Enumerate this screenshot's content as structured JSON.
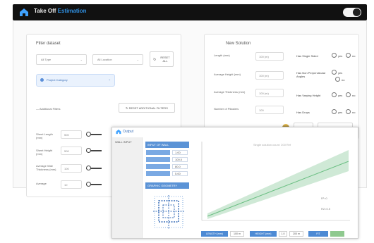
{
  "app": {
    "title_main": "Take Off",
    "title_sub": "Estimation"
  },
  "filter": {
    "title": "Filter dataset",
    "type_value": "All Type",
    "location_value": "All Location",
    "reset_label": "RESET ALL",
    "chip_label": "Project Category",
    "additional_label": "Additional Filters",
    "reset_additional_label": "RESET ADDITIONAL FILTERS",
    "rows": [
      {
        "label": "Sheet Length (mm)",
        "value": "500"
      },
      {
        "label": "Sheet Height (mm)",
        "value": "500"
      },
      {
        "label": "Average Wall Thickness (mm)",
        "value": "100"
      },
      {
        "label": "Average",
        "value": "10"
      }
    ]
  },
  "solution": {
    "title": "New Solution",
    "inputs": [
      {
        "label": "Length (mm)",
        "value": "100 (m)"
      },
      {
        "label": "Average Height (mm)",
        "value": "100 (m)"
      },
      {
        "label": "Average Thickness (mm)",
        "value": "100 (m)"
      },
      {
        "label": "Number of Pilasters",
        "value": "100"
      }
    ],
    "options": [
      {
        "label": "Has Single Sided",
        "yes": "yes",
        "no": "no"
      },
      {
        "label": "Has Non Perpendicular Angles",
        "yes": "yes",
        "no": "no"
      },
      {
        "label": "Has Varying Height",
        "yes": "yes",
        "no": "no"
      },
      {
        "label": "Has Drops",
        "yes": "yes",
        "no": "no"
      }
    ]
  },
  "dialog": {
    "title": "Output",
    "side_item": "WALL INPUT",
    "head_label": "INPUT OF WALL",
    "cell_values": [
      "1.00",
      "100.0",
      "80.0",
      "5.00"
    ],
    "bottom_label": "GRAPHIC GEOMETRY",
    "chart_watermark": "Single solution count: 200 Ref",
    "r2_lines": [
      "R²=0",
      "R2=0.5"
    ],
    "buttons": [
      "LENGTH (mm)",
      "HEIGHT (mm)",
      "FIT"
    ],
    "bottom_values": [
      "100 m",
      "200 m",
      "1.0",
      "100 m"
    ]
  },
  "colors": {
    "accent": "#2f8fe0",
    "blue": "#5b93d6",
    "green": "#8fc98f",
    "topbar": "#111111"
  }
}
